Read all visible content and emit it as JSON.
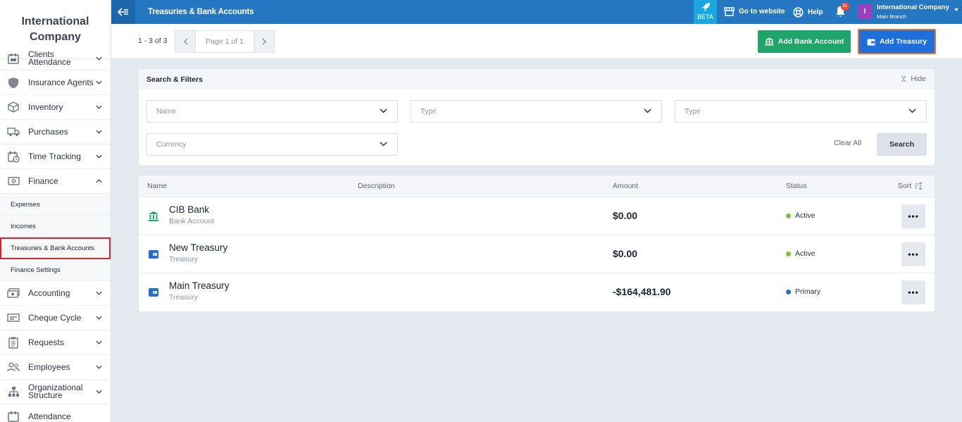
{
  "brand": {
    "line1": "International",
    "line2": "Company"
  },
  "sidebar": {
    "items_top": [
      {
        "label_line1": "Clients",
        "label_line2": "Attendance",
        "icon": "calendar-icon"
      },
      {
        "label": "Insurance Agents",
        "icon": "shield-icon"
      },
      {
        "label": "Inventory",
        "icon": "box-icon"
      },
      {
        "label": "Purchases",
        "icon": "truck-icon"
      },
      {
        "label": "Time Tracking",
        "icon": "clock-calendar-icon"
      },
      {
        "label": "Finance",
        "icon": "money-icon"
      }
    ],
    "finance_sub": [
      "Expenses",
      "Incomes",
      "Treasuries & Bank Accounts",
      "Finance Settings"
    ],
    "items_bottom": [
      {
        "label": "Accounting",
        "icon": "cash-icon"
      },
      {
        "label": "Cheque Cycle",
        "icon": "cheque-icon"
      },
      {
        "label": "Requests",
        "icon": "clipboard-icon"
      },
      {
        "label": "Employees",
        "icon": "users-icon"
      },
      {
        "label_line1": "Organizational",
        "label_line2": "Structure",
        "icon": "org-chart-icon"
      },
      {
        "label": "Attendance",
        "icon": "calendar-icon"
      }
    ]
  },
  "header": {
    "title": "Treasuries & Bank Accounts",
    "beta": "BETA",
    "go_to_website": "Go to website",
    "help": "Help",
    "notifications": "61",
    "user_initial": "I",
    "user_name": "International Company",
    "user_branch": "Main Branch"
  },
  "toolbar": {
    "count": "1 - 3 of 3",
    "page": "Page 1 of 1",
    "add_bank_account": "Add Bank Account",
    "add_treasury": "Add Treasury"
  },
  "filters": {
    "title": "Search & Filters",
    "hide": "Hide",
    "name_placeholder": "Name",
    "type1_placeholder": "Type",
    "type2_placeholder": "Type",
    "currency_placeholder": "Currency",
    "clear_all": "Clear All",
    "search": "Search"
  },
  "table": {
    "headers": {
      "name": "Name",
      "description": "Description",
      "amount": "Amount",
      "status": "Status",
      "sort": "Sort"
    },
    "rows": [
      {
        "name": "CIB Bank",
        "type": "Bank Account",
        "amount": "$0.00",
        "status": "Active",
        "status_color": "#7cc142",
        "icon": "bank-icon"
      },
      {
        "name": "New Treasury",
        "type": "Treasury",
        "amount": "$0.00",
        "status": "Active",
        "status_color": "#7cc142",
        "icon": "wallet-icon"
      },
      {
        "name": "Main Treasury",
        "type": "Treasury",
        "amount": "-$164,481.90",
        "status": "Primary",
        "status_color": "#1e6fd9",
        "icon": "wallet-icon"
      }
    ],
    "more": "•••"
  },
  "colors": {
    "header_blue": "#2677c2",
    "green": "#1fa46a",
    "blue": "#1e6fd9",
    "active_highlight": "#d9232d"
  }
}
